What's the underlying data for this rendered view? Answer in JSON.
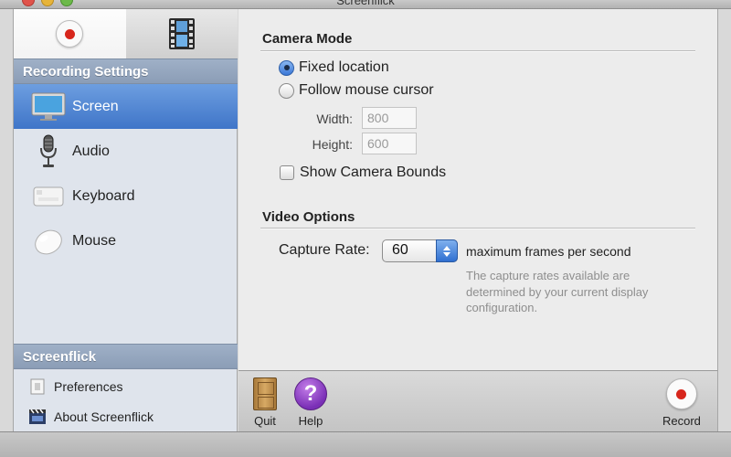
{
  "window": {
    "title": "Screenflick"
  },
  "sidebar": {
    "recording_settings_header": "Recording Settings",
    "items": [
      {
        "label": "Screen",
        "icon": "monitor-icon",
        "selected": true
      },
      {
        "label": "Audio",
        "icon": "microphone-icon",
        "selected": false
      },
      {
        "label": "Keyboard",
        "icon": "keyboard-icon",
        "selected": false
      },
      {
        "label": "Mouse",
        "icon": "mouse-icon",
        "selected": false
      }
    ],
    "app_header": "Screenflick",
    "footer": [
      {
        "label": "Preferences",
        "icon": "preferences-icon"
      },
      {
        "label": "About Screenflick",
        "icon": "film-clapper-icon"
      }
    ]
  },
  "camera_mode": {
    "title": "Camera Mode",
    "options": [
      {
        "label": "Fixed location",
        "checked": true
      },
      {
        "label": "Follow mouse cursor",
        "checked": false
      }
    ],
    "width_label": "Width:",
    "width_value": "800",
    "height_label": "Height:",
    "height_value": "600",
    "show_bounds_label": "Show Camera Bounds",
    "show_bounds_checked": false
  },
  "video_options": {
    "title": "Video Options",
    "capture_rate_label": "Capture Rate:",
    "capture_rate_value": "60",
    "capture_rate_suffix": "maximum frames per second",
    "note": "The capture rates available are determined by your current display configuration."
  },
  "toolbar": {
    "quit_label": "Quit",
    "help_label": "Help",
    "help_glyph": "?",
    "record_label": "Record"
  },
  "colors": {
    "selection": "#3f75c8",
    "section_header": "#8b9db6",
    "record_red": "#d7261c",
    "help_purple": "#7a2fb6"
  }
}
